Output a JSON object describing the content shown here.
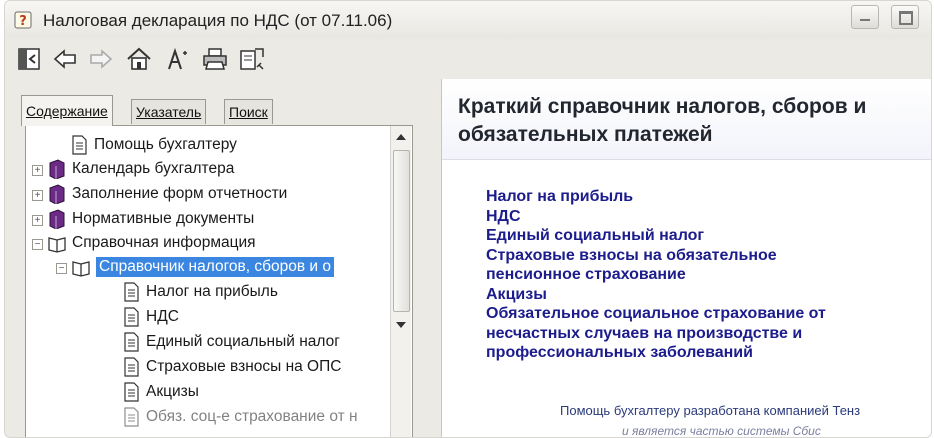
{
  "window": {
    "title": "Налоговая декларация по НДС (от 07.11.06)"
  },
  "toolbar": {
    "buttons": [
      "hide-pane",
      "back",
      "forward",
      "home",
      "font",
      "print",
      "options"
    ]
  },
  "tabs": [
    {
      "label": "Содержание",
      "active": true
    },
    {
      "label": "Указатель",
      "active": false
    },
    {
      "label": "Поиск",
      "active": false
    }
  ],
  "tree": {
    "items": [
      {
        "label": "Помощь бухгалтеру",
        "icon": "page-icon",
        "expander": ""
      },
      {
        "label": "Календарь бухгалтера",
        "icon": "book-closed-icon",
        "expander": "+"
      },
      {
        "label": "Заполнение форм отчетности",
        "icon": "book-closed-icon",
        "expander": "+"
      },
      {
        "label": "Нормативные документы",
        "icon": "book-closed-icon",
        "expander": "+"
      },
      {
        "label": "Справочная информация",
        "icon": "book-open-icon",
        "expander": "−"
      },
      {
        "label": "Справочник налогов, сборов и о",
        "icon": "book-open-icon",
        "expander": "−",
        "selected": true
      },
      {
        "label": "Налог на прибыль",
        "icon": "page-icon",
        "expander": ""
      },
      {
        "label": "НДС",
        "icon": "page-icon",
        "expander": ""
      },
      {
        "label": "Единый социальный налог",
        "icon": "page-icon",
        "expander": ""
      },
      {
        "label": "Страховые взносы на ОПС",
        "icon": "page-icon",
        "expander": ""
      },
      {
        "label": "Акцизы",
        "icon": "page-icon",
        "expander": ""
      },
      {
        "label": "Обяз. соц-е страхование от н",
        "icon": "page-icon",
        "expander": ""
      }
    ]
  },
  "content": {
    "heading_line1": "Краткий справочник налогов, сборов и",
    "heading_line2": "обязательных платежей",
    "links": [
      "Налог на прибыль",
      "НДС",
      "Единый социальный налог",
      "Страховые взносы на обязательное",
      "пенсионное страхование",
      "Акцизы",
      "Обязательное социальное страхование от",
      "несчастных случаев на производстве и",
      "профессиональных заболеваний"
    ],
    "footer_line1": "Помощь бухгалтеру разработана компанией Тенз",
    "footer_line2": "и является частью системы Сбис"
  },
  "colors": {
    "link": "#1c1c8c",
    "selection": "#3a86e0",
    "book": "#6b2a84"
  }
}
